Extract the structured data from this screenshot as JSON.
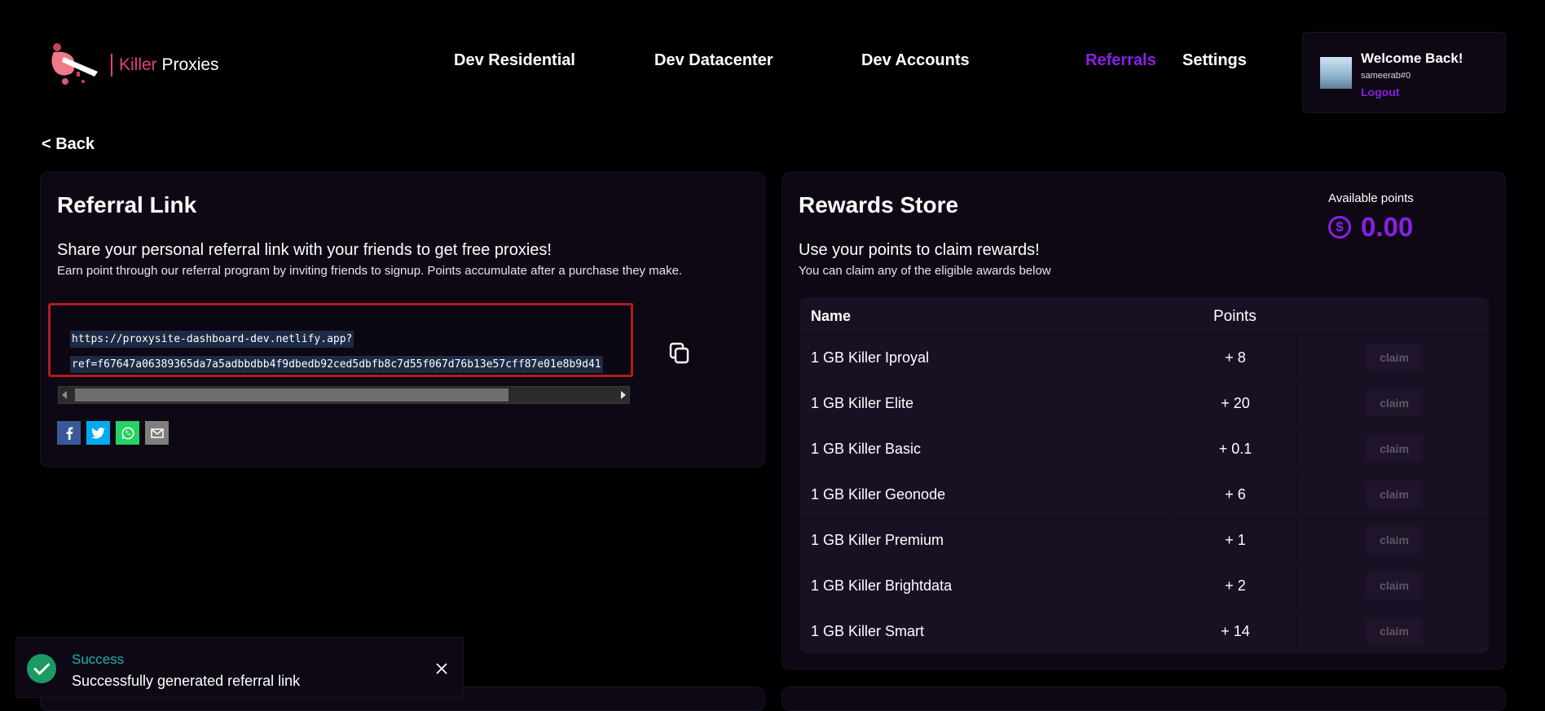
{
  "brand": {
    "name_part1": "Killer",
    "name_part2": "Proxies",
    "accent": "#e5427a"
  },
  "nav": {
    "items": [
      {
        "label": "Dev Residential"
      },
      {
        "label": "Dev Datacenter"
      },
      {
        "label": "Dev Accounts"
      },
      {
        "label": "Referrals",
        "active": true
      },
      {
        "label": "Settings"
      }
    ],
    "active_color": "#8a1fe6"
  },
  "user": {
    "welcome": "Welcome Back!",
    "username": "sameerab#0",
    "logout_label": "Logout"
  },
  "back_label": "< Back",
  "referral": {
    "title": "Referral Link",
    "subtitle": "Share your personal referral link with your friends to get free proxies!",
    "description": "Earn point through our referral program by inviting friends to signup. Points accumulate after a purchase they make.",
    "link_line1": "https://proxysite-dashboard-dev.netlify.app?",
    "link_line2": "ref=f67647a06389365da7a5adbbdbb4f9dbedb92ced5dbfb8c7d55f067d76b13e57cff87e01e8b9d41",
    "share_icons": [
      "facebook-icon",
      "twitter-icon",
      "whatsapp-icon",
      "email-icon"
    ]
  },
  "rewards": {
    "title": "Rewards Store",
    "subtitle": "Use your points to claim rewards!",
    "description": "You can claim any of the eligible awards below",
    "available_label": "Available points",
    "available_points": "0.00",
    "table": {
      "col_name": "Name",
      "col_points": "Points",
      "rows": [
        {
          "name": "1 GB Killer Iproyal",
          "points": "+ 8",
          "action": "claim"
        },
        {
          "name": "1 GB Killer Elite",
          "points": "+ 20",
          "action": "claim"
        },
        {
          "name": "1 GB Killer Basic",
          "points": "+ 0.1",
          "action": "claim"
        },
        {
          "name": "1 GB Killer Geonode",
          "points": "+ 6",
          "action": "claim"
        },
        {
          "name": "1 GB Killer Premium",
          "points": "+ 1",
          "action": "claim"
        },
        {
          "name": "1 GB Killer Brightdata",
          "points": "+ 2",
          "action": "claim"
        },
        {
          "name": "1 GB Killer Smart",
          "points": "+ 14",
          "action": "claim"
        }
      ]
    }
  },
  "toast": {
    "title": "Success",
    "message": "Successfully generated referral link"
  }
}
